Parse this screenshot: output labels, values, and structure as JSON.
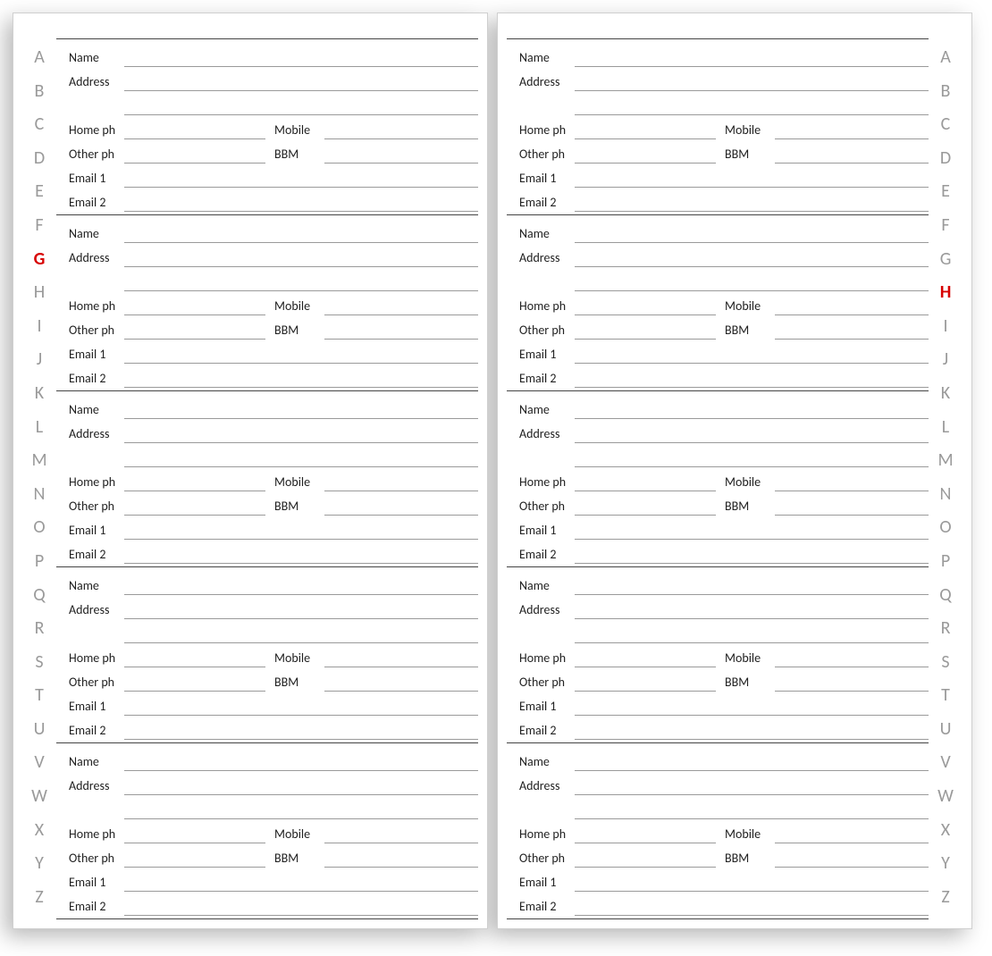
{
  "alphabet": [
    "A",
    "B",
    "C",
    "D",
    "E",
    "F",
    "G",
    "H",
    "I",
    "J",
    "K",
    "L",
    "M",
    "N",
    "O",
    "P",
    "Q",
    "R",
    "S",
    "T",
    "U",
    "V",
    "W",
    "X",
    "Y",
    "Z"
  ],
  "left_active_tab": "G",
  "right_active_tab": "H",
  "entries_per_page": 5,
  "labels": {
    "name": "Name",
    "address": "Address",
    "home_ph": "Home ph",
    "mobile": "Mobile",
    "other_ph": "Other ph",
    "bbm": "BBM",
    "email1": "Email 1",
    "email2": "Email 2"
  }
}
